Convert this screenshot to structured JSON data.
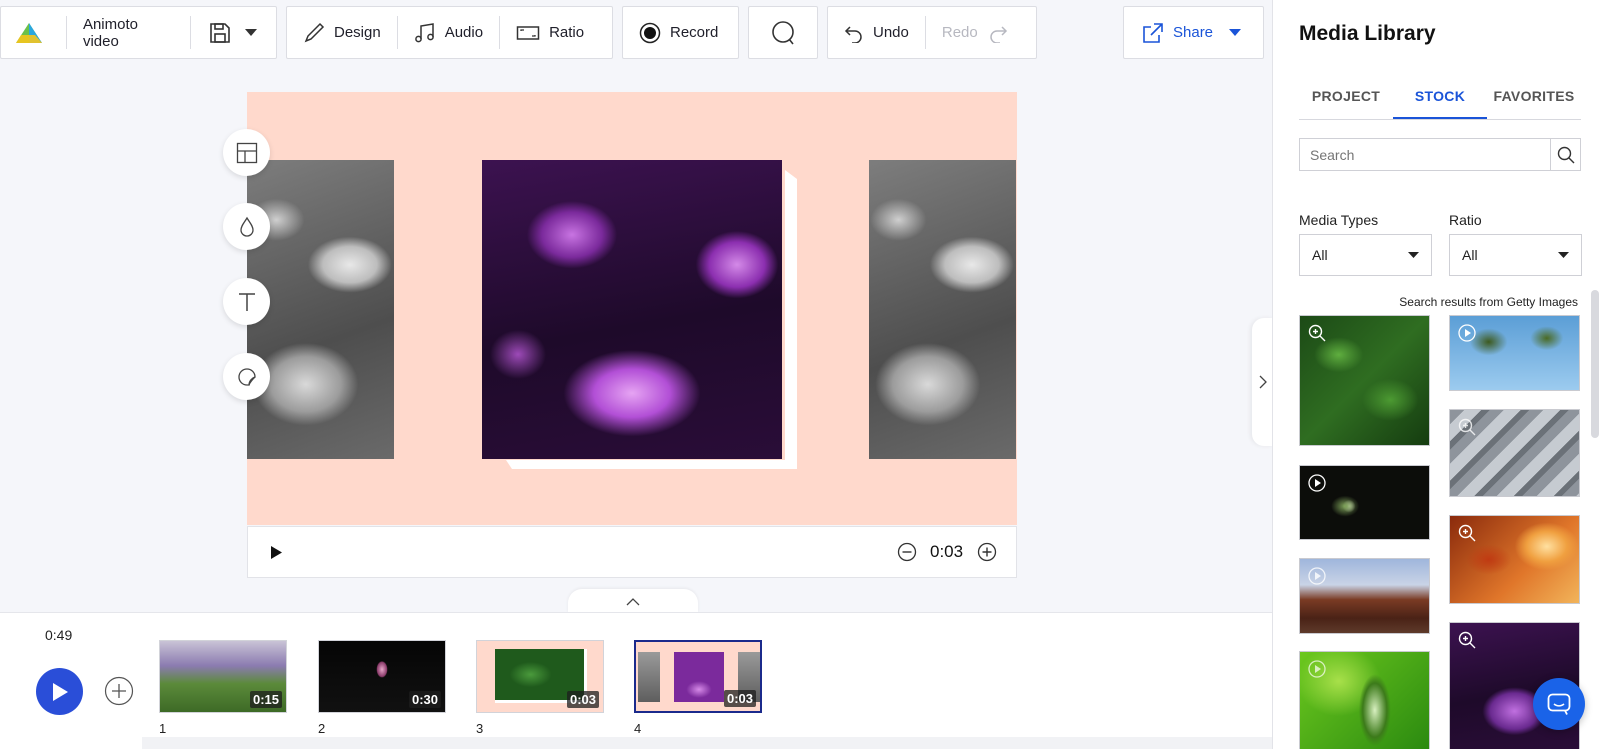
{
  "toolbar": {
    "project_name": "Animoto video",
    "design": "Design",
    "audio": "Audio",
    "ratio": "Ratio",
    "record": "Record",
    "undo": "Undo",
    "redo": "Redo",
    "share": "Share"
  },
  "player": {
    "time": "0:03"
  },
  "timeline": {
    "total_duration": "0:49",
    "blocks": [
      {
        "number": "1",
        "duration": "0:15"
      },
      {
        "number": "2",
        "duration": "0:30"
      },
      {
        "number": "3",
        "duration": "0:03"
      },
      {
        "number": "4",
        "duration": "0:03",
        "selected": true
      }
    ]
  },
  "library": {
    "title": "Media Library",
    "tabs": [
      "PROJECT",
      "STOCK",
      "FAVORITES"
    ],
    "active_tab": "STOCK",
    "search_placeholder": "Search",
    "filters": {
      "media_types_label": "Media Types",
      "media_types_value": "All",
      "ratio_label": "Ratio",
      "ratio_value": "All"
    },
    "results_caption": "Search results from Getty Images"
  },
  "colors": {
    "accent": "#1a54d8",
    "stage_background": "#ffd9cc",
    "play_button": "#2a4ed8"
  }
}
